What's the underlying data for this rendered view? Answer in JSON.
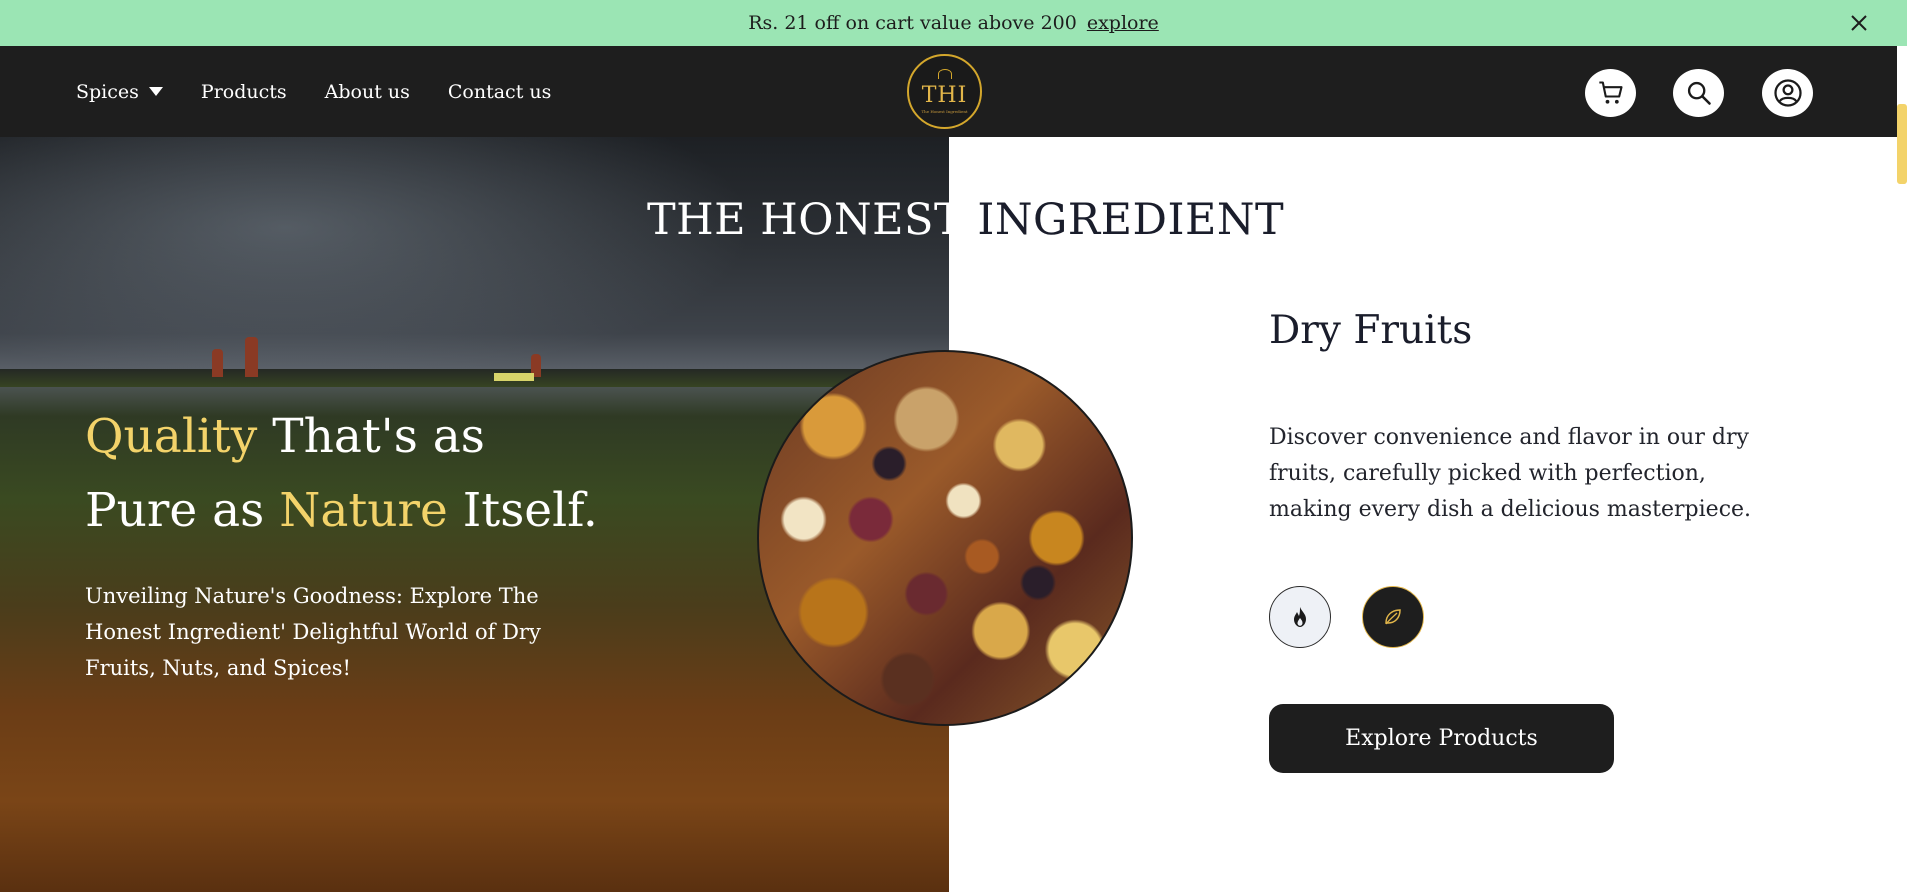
{
  "promo": {
    "text": "Rs. 21 off on cart value above 200",
    "link": "explore",
    "close_icon": "close-icon"
  },
  "header": {
    "nav": [
      {
        "label": "Spices",
        "has_dropdown": true
      },
      {
        "label": "Products"
      },
      {
        "label": "About us"
      },
      {
        "label": "Contact us"
      }
    ],
    "logo": {
      "text": "THI",
      "subtext": "The Honest Ingredient"
    },
    "icons": [
      "cart-icon",
      "search-icon",
      "account-icon"
    ]
  },
  "hero": {
    "site_title_light": "THE HONEST",
    "site_title_dark": "INGREDIENT",
    "headline": {
      "w1": "Quality",
      "w2": " That's as",
      "w3": "Pure as ",
      "w4": "Nature",
      "w5": " Itself."
    },
    "tagline": "Unveiling Nature's Goodness: Explore The Honest Ingredient' Delightful World of Dry Fruits, Nuts, and Spices!"
  },
  "feature": {
    "title": "Dry Fruits",
    "description": "Discover convenience and flavor in our dry fruits, carefully picked with perfection, making every dish a delicious masterpiece.",
    "buttons": [
      "flame-icon",
      "leaf-icon"
    ],
    "cta": "Explore Products"
  },
  "colors": {
    "promo_bg": "#9be5b4",
    "header_bg": "#1e1e1e",
    "accent_gold": "#f3d36a",
    "text_dark": "#1a1d2b"
  }
}
